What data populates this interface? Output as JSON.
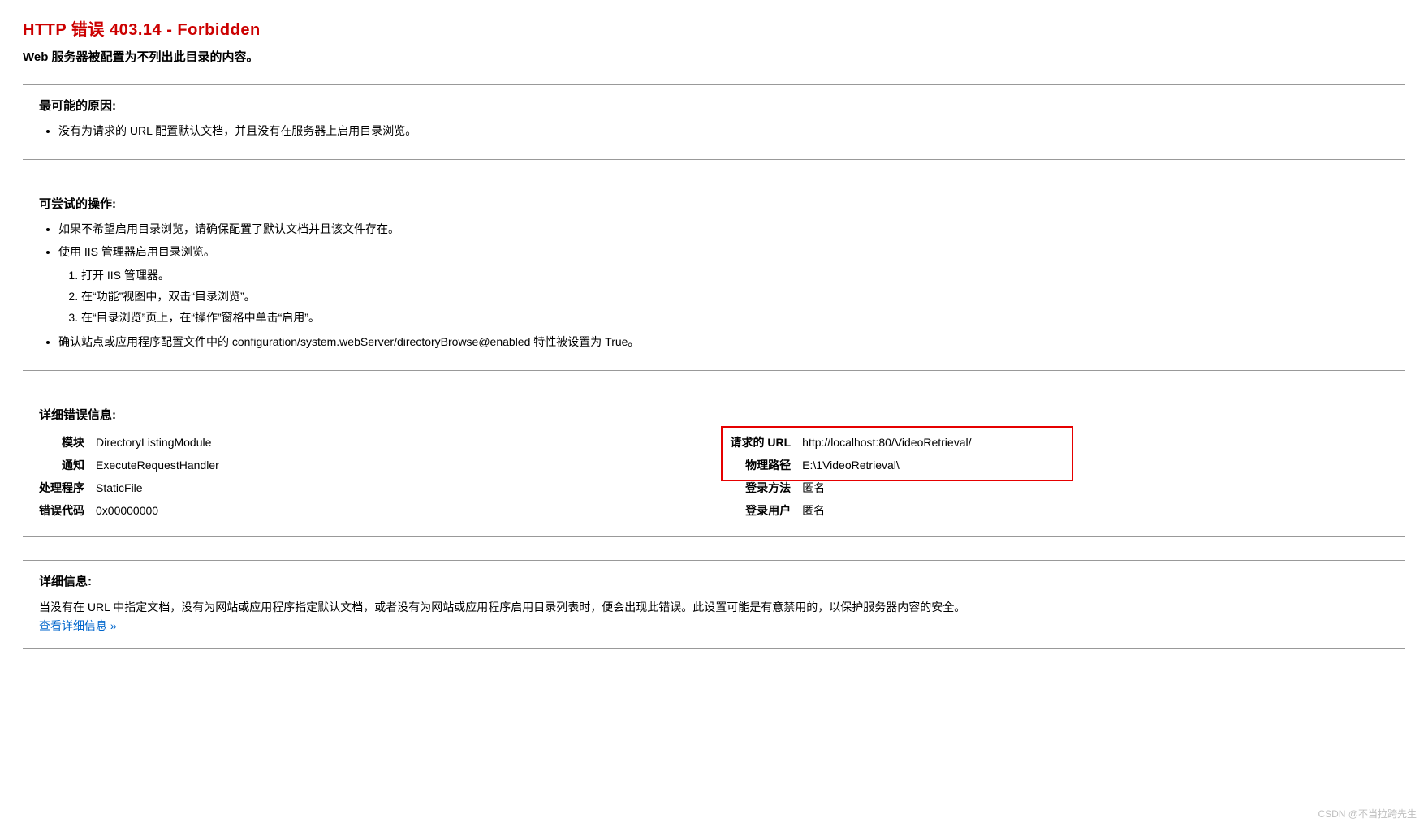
{
  "header": {
    "title": "HTTP 错误 403.14 - Forbidden",
    "subtitle": "Web 服务器被配置为不列出此目录的内容。"
  },
  "causes": {
    "title": "最可能的原因:",
    "items": [
      "没有为请求的 URL 配置默认文档，并且没有在服务器上启用目录浏览。"
    ]
  },
  "actions": {
    "title": "可尝试的操作:",
    "items": [
      "如果不希望启用目录浏览，请确保配置了默认文档并且该文件存在。",
      "使用 IIS 管理器启用目录浏览。"
    ],
    "steps": [
      "打开 IIS 管理器。",
      "在“功能”视图中，双击“目录浏览”。",
      "在“目录浏览”页上，在“操作”窗格中单击“启用”。"
    ],
    "extra": "确认站点或应用程序配置文件中的 configuration/system.webServer/directoryBrowse@enabled 特性被设置为 True。"
  },
  "details": {
    "title": "详细错误信息:",
    "left": [
      {
        "k": "模块",
        "v": "DirectoryListingModule"
      },
      {
        "k": "通知",
        "v": "ExecuteRequestHandler"
      },
      {
        "k": "处理程序",
        "v": "StaticFile"
      },
      {
        "k": "错误代码",
        "v": "0x00000000"
      }
    ],
    "right": [
      {
        "k": "请求的 URL",
        "v": "http://localhost:80/VideoRetrieval/"
      },
      {
        "k": "物理路径",
        "v": "E:\\1VideoRetrieval\\"
      },
      {
        "k": "登录方法",
        "v": "匿名"
      },
      {
        "k": "登录用户",
        "v": "匿名"
      }
    ]
  },
  "moreinfo": {
    "title": "详细信息:",
    "text": "当没有在 URL 中指定文档，没有为网站或应用程序指定默认文档，或者没有为网站或应用程序启用目录列表时，便会出现此错误。此设置可能是有意禁用的，以保护服务器内容的安全。",
    "link_text": "查看详细信息 »"
  },
  "watermark": "CSDN @不当拉跨先生"
}
